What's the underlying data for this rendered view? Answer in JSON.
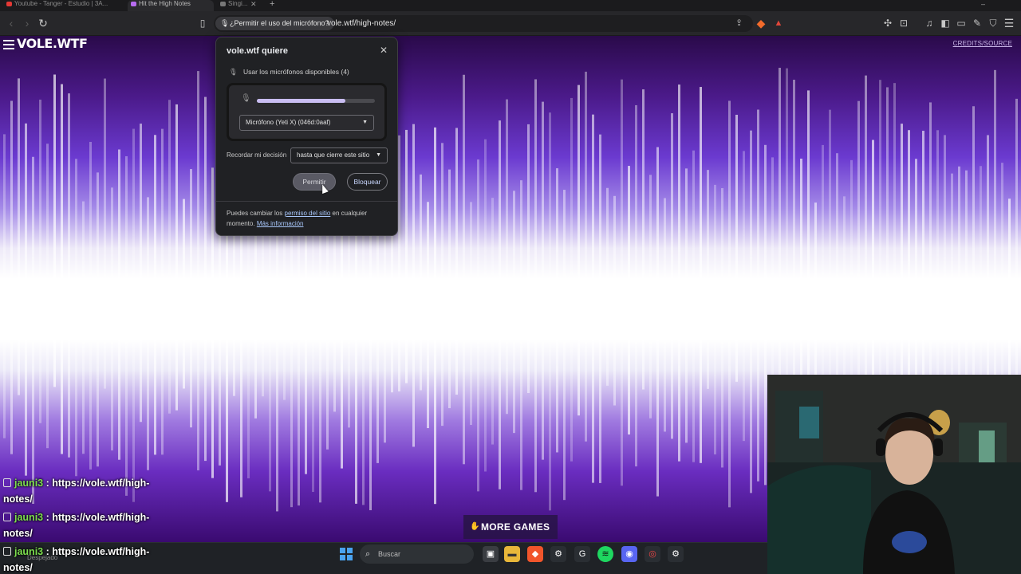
{
  "browser": {
    "tabs": [
      {
        "label": "Youtube - Tanger - Estudio | 3A...",
        "color": "#e53935"
      },
      {
        "label": "Hit the High Notes",
        "color": "#b76cf0"
      },
      {
        "label": "Singi...",
        "color": "#777777"
      }
    ],
    "permission_chip": "¿Permitir el uso del micrófono?",
    "url": "vole.wtf/high-notes/"
  },
  "page": {
    "logo": "VOLE.WTF",
    "credits": "CREDITS/SOURCE",
    "more_games": "MORE GAMES"
  },
  "permission_popup": {
    "title": "vole.wtf quiere",
    "mic_label": "Usar los micrófonos disponibles (4)",
    "mic_level": 0.75,
    "mic_device": "Micrófono (Yeti X) (046d:0aaf)",
    "remember_label": "Recordar mi decisión",
    "remember_value": "hasta que cierre este sitio",
    "allow": "Permitir",
    "block": "Bloquear",
    "footer_text_1": "Puedes cambiar los",
    "footer_link_1": "permiso del sitio",
    "footer_text_2": "en cualquier momento.",
    "footer_link_2": "Más información"
  },
  "chat": [
    {
      "user": "jauni3",
      "message": ": https://vole.wtf/high-notes/"
    },
    {
      "user": "jauni3",
      "message": ": https://vole.wtf/high-notes/"
    },
    {
      "user": "jauni3",
      "message": ": https://vole.wtf/high-notes/"
    }
  ],
  "taskbar": {
    "weather": "Despejado",
    "search_placeholder": "Buscar"
  }
}
